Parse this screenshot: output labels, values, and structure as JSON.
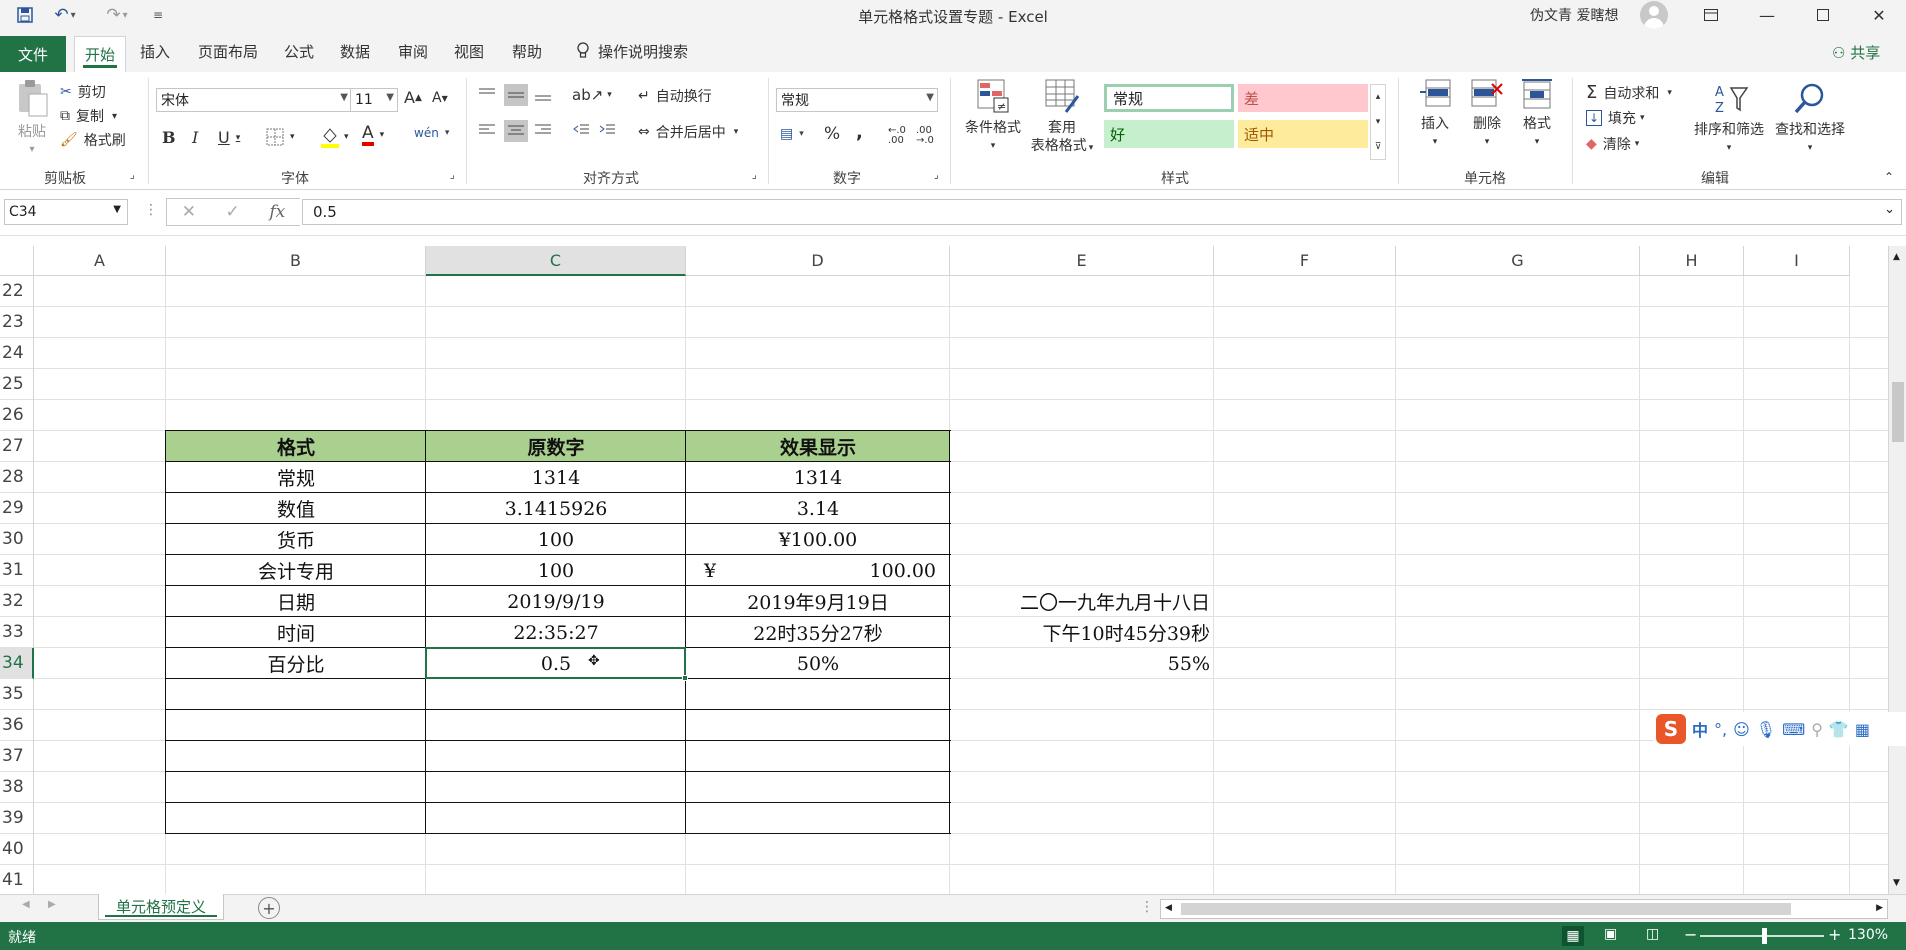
{
  "titlebar": {
    "title": "单元格格式设置专题  -  Excel",
    "user": "伪文青 爱瞎想"
  },
  "tabs": {
    "file": "文件",
    "home": "开始",
    "insert": "插入",
    "page_layout": "页面布局",
    "formulas": "公式",
    "data": "数据",
    "review": "审阅",
    "view": "视图",
    "help": "帮助",
    "tell_me": "操作说明搜索",
    "share": "共享"
  },
  "ribbon": {
    "clipboard": {
      "paste": "粘贴",
      "cut": "剪切",
      "copy": "复制",
      "format_painter": "格式刷",
      "label": "剪贴板"
    },
    "font": {
      "name": "宋体",
      "size": "11",
      "label": "字体"
    },
    "alignment": {
      "wrap": "自动换行",
      "merge": "合并后居中",
      "label": "对齐方式"
    },
    "number": {
      "format": "常规",
      "label": "数字"
    },
    "styles": {
      "conditional": "条件格式",
      "table_line1": "套用",
      "table_line2": "表格格式",
      "normal": "常规",
      "bad": "差",
      "good": "好",
      "neutral": "适中",
      "label": "样式"
    },
    "cells": {
      "insert": "插入",
      "delete": "删除",
      "format": "格式",
      "label": "单元格"
    },
    "editing": {
      "autosum": "自动求和",
      "fill": "填充",
      "clear": "清除",
      "sort": "排序和筛选",
      "find": "查找和选择",
      "label": "编辑"
    }
  },
  "formula_bar": {
    "name_box": "C34",
    "value": "0.5"
  },
  "columns": [
    "A",
    "B",
    "C",
    "D",
    "E",
    "F",
    "G",
    "H",
    "I"
  ],
  "rows": [
    "22",
    "23",
    "24",
    "25",
    "26",
    "27",
    "28",
    "29",
    "30",
    "31",
    "32",
    "33",
    "34",
    "35",
    "36",
    "37",
    "38",
    "39",
    "40",
    "41"
  ],
  "table": {
    "headers": [
      "格式",
      "原数字",
      "效果显示"
    ],
    "rows": [
      [
        "常规",
        "1314",
        "1314"
      ],
      [
        "数值",
        "3.1415926",
        "3.14"
      ],
      [
        "货币",
        "100",
        "¥100.00"
      ],
      [
        "会计专用",
        "100",
        "100.00"
      ],
      [
        "日期",
        "2019/9/19",
        "2019年9月19日"
      ],
      [
        "时间",
        "22:35:27",
        "22时35分27秒"
      ],
      [
        "百分比",
        "0.5",
        "50%"
      ]
    ],
    "accounting_symbol": "¥"
  },
  "col_e": {
    "r32": "二〇一九年九月十八日",
    "r33": "下午10时45分39秒",
    "r34": "55%"
  },
  "sheet_tab": "单元格预定义",
  "status": {
    "ready": "就绪",
    "zoom": "130%"
  },
  "ime": {
    "mode": "中"
  },
  "colors": {
    "accent": "#217346",
    "header_fill": "#a9d08e",
    "normal_style": "#ffffff",
    "bad_fill": "#ffc7ce",
    "good_fill": "#c6efce",
    "neutral_fill": "#ffeb9c"
  }
}
